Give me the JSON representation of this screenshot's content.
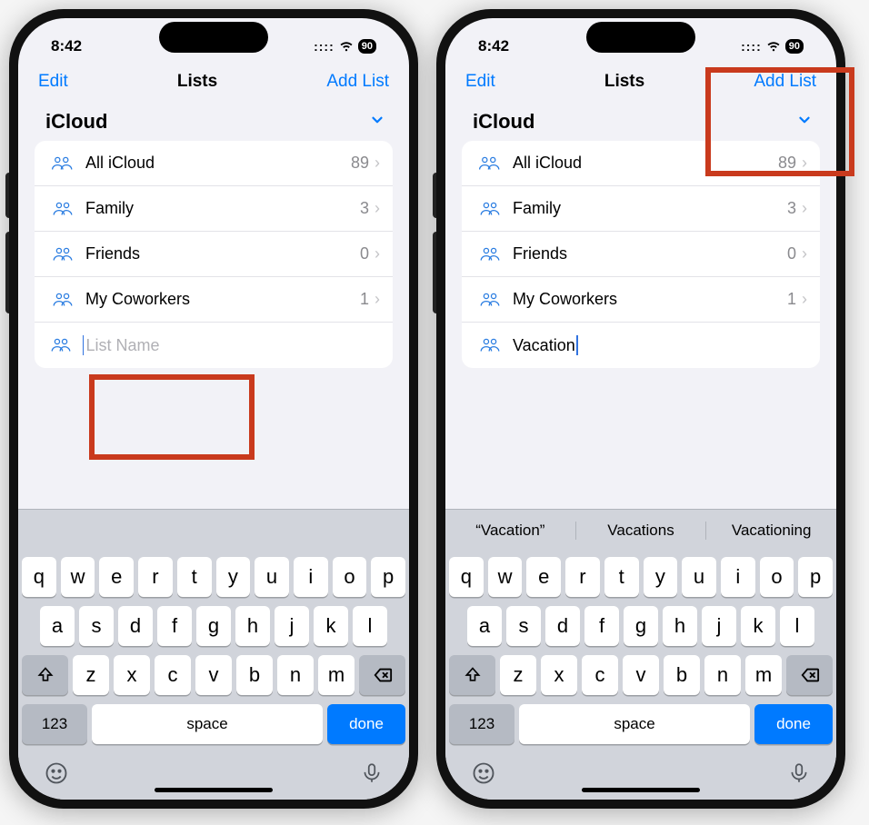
{
  "status": {
    "time": "8:42",
    "battery": "90"
  },
  "nav": {
    "left": "Edit",
    "title": "Lists",
    "right": "Add List"
  },
  "section": {
    "title": "iCloud"
  },
  "lists": [
    {
      "label": "All iCloud",
      "count": "89",
      "multi": true
    },
    {
      "label": "Family",
      "count": "3",
      "multi": false
    },
    {
      "label": "Friends",
      "count": "0",
      "multi": false
    },
    {
      "label": "My Coworkers",
      "count": "1",
      "multi": false
    }
  ],
  "left": {
    "input": {
      "placeholder": "List Name",
      "value": ""
    },
    "suggestions": [
      "",
      "",
      ""
    ]
  },
  "right": {
    "input": {
      "value": "Vacation"
    },
    "suggestions": [
      "“Vacation”",
      "Vacations",
      "Vacationing"
    ]
  },
  "keyboard": {
    "row1": [
      "q",
      "w",
      "e",
      "r",
      "t",
      "y",
      "u",
      "i",
      "o",
      "p"
    ],
    "row2": [
      "a",
      "s",
      "d",
      "f",
      "g",
      "h",
      "j",
      "k",
      "l"
    ],
    "row3": [
      "z",
      "x",
      "c",
      "v",
      "b",
      "n",
      "m"
    ],
    "numKey": "123",
    "spaceKey": "space",
    "doneKey": "done"
  }
}
